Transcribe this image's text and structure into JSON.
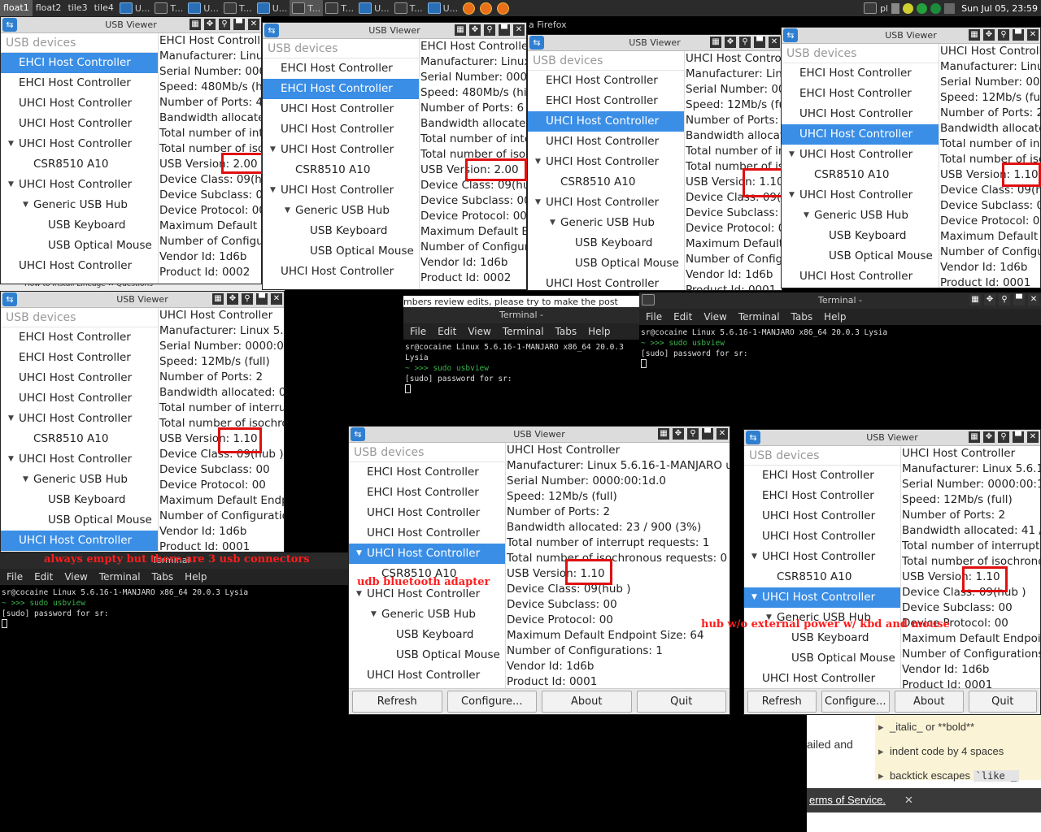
{
  "taskbar": {
    "workspaces": [
      "float1",
      "float2",
      "tile3",
      "tile4"
    ],
    "tasks": [
      "U...",
      "T...",
      "U...",
      "T...",
      "U...",
      "T...",
      "T...",
      "U...",
      "T...",
      "U..."
    ],
    "firefox_label": "Firefox",
    "tray_pl": "pl",
    "clock": "Sun Jul 05, 23:59"
  },
  "usbviewer": {
    "window_title": "USB Viewer",
    "tree_header": "USB devices",
    "tree_items": [
      "EHCI Host Controller",
      "EHCI Host Controller",
      "UHCI Host Controller",
      "UHCI Host Controller",
      "UHCI Host Controller",
      "CSR8510 A10",
      "UHCI Host Controller",
      "Generic USB Hub",
      "USB Keyboard",
      "USB Optical Mouse",
      "UHCI Host Controller"
    ],
    "buttons": {
      "refresh": "Refresh",
      "configure": "Configure...",
      "about": "About",
      "quit": "Quit"
    },
    "win1_details": [
      "EHCI Host Controller",
      "Manufacturer: Linux",
      "Serial Number: 0000",
      "Speed: 480Mb/s (hig",
      "Number of Ports: 4",
      "Bandwidth allocated:",
      "Total number of inte",
      "Total number of isoc",
      "USB Version: 2.00",
      "Device Class: 09(hub",
      "Device Subclass: 00",
      "Device Protocol: 00",
      "Maximum Default En",
      "Number of Configura",
      "Vendor Id: 1d6b",
      "Product Id: 0002"
    ],
    "win2_details": [
      "EHCI Host Controller",
      "Manufacturer: Linux",
      "Serial Number: 0000:",
      "Speed: 480Mb/s (high",
      "Number of Ports: 6",
      "Bandwidth allocated:",
      "Total number of inter",
      "Total number of isoch",
      "USB Version: 2.00",
      "Device Class: 09(hub",
      "Device Subclass: 00",
      "Device Protocol: 00",
      "Maximum Default End",
      "Number of Configura",
      "Vendor Id: 1d6b",
      "Product Id: 0002"
    ],
    "win3_details": [
      "UHCI Host Controll",
      "Manufacturer: Linu",
      "Serial Number: 000",
      "Speed: 12Mb/s (full",
      "Number of Ports: 2",
      "Bandwidth allocate",
      "Total number of int",
      "Total number of iso",
      "USB Version: 1.10",
      "Device Class: 09(hu",
      "Device Subclass: 00",
      "Device Protocol: 00",
      "Maximum Default E",
      "Number of Configu",
      "Vendor Id: 1d6b",
      "Product Id: 0001"
    ],
    "win4_details": [
      "UHCI Host Controller",
      "Manufacturer: Linux",
      "Serial Number: 0000",
      "Speed: 12Mb/s (full)",
      "Number of Ports: 2",
      "Bandwidth allocated:",
      "Total number of inte",
      "Total number of isoc",
      "USB Version: 1.10",
      "Device Class: 09(hub",
      "Device Subclass: 00",
      "Device Protocol: 00",
      "Maximum Default En",
      "Number of Configura",
      "Vendor Id: 1d6b",
      "Product Id: 0001"
    ],
    "win5_details": [
      "UHCI Host Controller",
      "Manufacturer: Linux 5.6.1",
      "Serial Number: 0000:00:1",
      "Speed: 12Mb/s (full)",
      "Number of Ports: 2",
      "Bandwidth allocated: 0 / 9",
      "Total number of interrupt",
      "Total number of isochron",
      "USB Version: 1.10",
      "Device Class: 09(hub )",
      "Device Subclass: 00",
      "Device Protocol: 00",
      "Maximum Default Endpoi",
      "Number of Configuration",
      "Vendor Id: 1d6b",
      "Product Id: 0001"
    ],
    "win6_details": [
      "UHCI Host Controller",
      "Manufacturer: Linux 5.6.16-1-MANJARO uhci_",
      "Serial Number: 0000:00:1d.0",
      "Speed: 12Mb/s (full)",
      "Number of Ports: 2",
      "Bandwidth allocated: 23 / 900 (3%)",
      "Total number of interrupt requests: 1",
      "Total number of isochronous requests: 0",
      "USB Version: 1.10",
      "Device Class: 09(hub )",
      "Device Subclass: 00",
      "Device Protocol: 00",
      "Maximum Default Endpoint Size: 64",
      "Number of Configurations: 1",
      "Vendor Id: 1d6b",
      "Product Id: 0001"
    ],
    "win7_details": [
      "UHCI Host Controller",
      "Manufacturer: Linux 5.6.16-",
      "Serial Number: 0000:00:1d.",
      "Speed: 12Mb/s (full)",
      "Number of Ports: 2",
      "Bandwidth allocated: 41 / 90",
      "Total number of interrupt re",
      "Total number of isochronous",
      "USB Version: 1.10",
      "Device Class: 09(hub )",
      "Device Subclass: 00",
      "Device Protocol: 00",
      "Maximum Default Endpoint S",
      "Number of Configurations: 1",
      "Vendor Id: 1d6b",
      "Product Id: 0001"
    ]
  },
  "terminal": {
    "title": "Terminal -",
    "menu": [
      "File",
      "Edit",
      "View",
      "Terminal",
      "Tabs",
      "Help"
    ],
    "banner": "sr@cocaine Linux 5.6.16-1-MANJARO x86_64 20.0.3 Lysia",
    "prompt": "~ >>>",
    "command": "sudo usbview",
    "password_prompt": "[sudo] password for sr:"
  },
  "background_text": {
    "firefox_title": "a Firefox",
    "edit_hint": "mbers review edits, please try to make the post",
    "tab1": "How to install Lineage",
    "tab2": "Questions",
    "failed_and": "ailed and",
    "terms": "erms of Service.",
    "tip1_a": "_italic_",
    "tip1_b": "or",
    "tip1_c": "**bold**",
    "tip2": "indent code by 4 spaces",
    "tip3_a": "backtick escapes",
    "tip3_b": "`like _"
  },
  "annotations": {
    "empty_connectors": "always empty but there are 3 usb connectors",
    "bluetooth": "udb bluetooth adapter",
    "hub": "hub w/o external power w/ kbd and mouse"
  }
}
